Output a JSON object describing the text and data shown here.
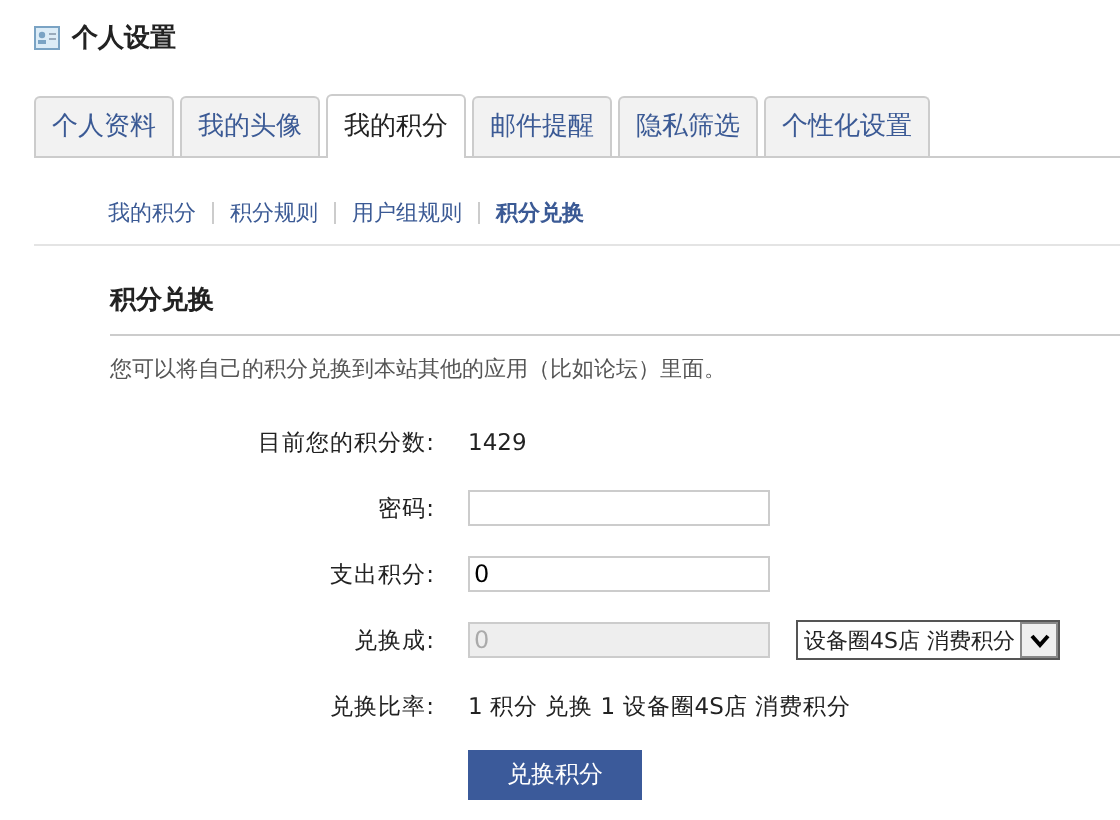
{
  "page_title": "个人设置",
  "tabs": [
    {
      "label": "个人资料",
      "selected": false
    },
    {
      "label": "我的头像",
      "selected": false
    },
    {
      "label": "我的积分",
      "selected": true
    },
    {
      "label": "邮件提醒",
      "selected": false
    },
    {
      "label": "隐私筛选",
      "selected": false
    },
    {
      "label": "个性化设置",
      "selected": false
    }
  ],
  "subnav": [
    {
      "label": "我的积分",
      "selected": false
    },
    {
      "label": "积分规则",
      "selected": false
    },
    {
      "label": "用户组规则",
      "selected": false
    },
    {
      "label": "积分兑换",
      "selected": true
    }
  ],
  "section_title": "积分兑换",
  "description": "您可以将自己的积分兑换到本站其他的应用（比如论坛）里面。",
  "form": [
    {
      "kind": "text",
      "label": "目前您的积分数:",
      "value": "1429"
    },
    {
      "kind": "input",
      "label": "密码:",
      "disabled": false
    },
    {
      "kind": "input",
      "label": "支出积分:",
      "value": "0",
      "disabled": false
    },
    {
      "kind": "input",
      "label": "兑换成:",
      "value": "0",
      "disabled": true,
      "select": "设备圈4S店 消费积分"
    },
    {
      "kind": "text",
      "label": "兑换比率:",
      "value": "1 积分 兑换 1 设备圈4S店  消费积分"
    }
  ],
  "submit": "兑换积分"
}
